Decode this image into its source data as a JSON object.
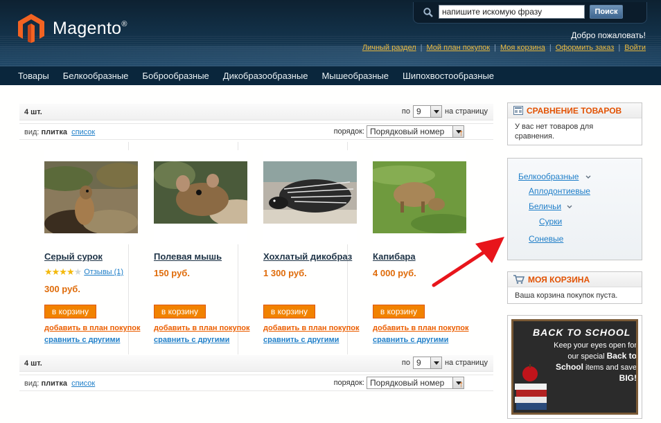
{
  "header": {
    "logo_text": "Magento",
    "logo_reg": "®",
    "search_placeholder": "напишите искомую фразу",
    "search_button": "Поиск",
    "welcome": "Добро пожаловать!",
    "links": [
      "Личный раздел",
      "Мой план покупок",
      "Моя корзина",
      "Оформить заказ",
      "Войти"
    ]
  },
  "nav": [
    "Товары",
    "Белкообразные",
    "Боброобразные",
    "Дикобразообразные",
    "Мышеобразные",
    "Шипохвостообразные"
  ],
  "toolbar": {
    "count": "4 шт.",
    "per_page_prefix": "по",
    "per_page_value": "9",
    "per_page_suffix": "на страницу",
    "view_label": "вид:",
    "view_grid": "плитка",
    "view_list": "список",
    "order_label": "порядок:",
    "order_value": "Порядковый номер",
    "sort_arrow": "↑"
  },
  "products": [
    {
      "name": "Серый сурок",
      "price": "300 руб.",
      "rating": 4,
      "reviews": "Отзывы (1)",
      "cart": "в корзину",
      "wish": "добавить в план покупок",
      "compare": "сравнить с другими",
      "image": "marmot"
    },
    {
      "name": "Полевая мышь",
      "price": "150 руб.",
      "cart": "в корзину",
      "wish": "добавить в план покупок",
      "compare": "сравнить с другими",
      "image": "mouse"
    },
    {
      "name": "Хохлатый дикобраз",
      "price": "1 300 руб.",
      "cart": "в корзину",
      "wish": "добавить в план покупок",
      "compare": "сравнить с другими",
      "image": "porcupine"
    },
    {
      "name": "Капибара",
      "price": "4 000 руб.",
      "cart": "в корзину",
      "wish": "добавить в план покупок",
      "compare": "сравнить с другими",
      "image": "capybara"
    }
  ],
  "sidebar": {
    "compare_title": "СРАВНЕНИЕ ТОВАРОВ",
    "compare_text": "У вас нет товаров для сравнения.",
    "tree": [
      "Белкообразные",
      "Аплодонтиевые",
      "Беличьи",
      "Сурки",
      "Соневые"
    ],
    "cart_title": "МОЯ КОРЗИНА",
    "cart_text": "Ваша корзина покупок пуста.",
    "banner": {
      "headline": "BACK TO SCHOOL",
      "line1": "Keep your eyes open for our special",
      "bold1": "Back to School",
      "line2": "items and save",
      "bold2": "BIG!"
    }
  },
  "colors": {
    "accent": "#df6b09",
    "link": "#1e7ec8",
    "header": "#13324a",
    "nav": "#0a263c"
  }
}
